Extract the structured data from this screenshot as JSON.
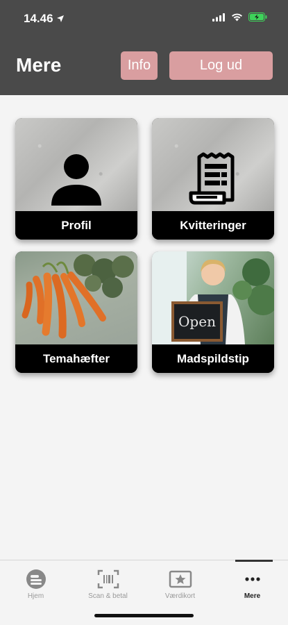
{
  "status_bar": {
    "time": "14.46"
  },
  "header": {
    "title": "Mere",
    "info_label": "Info",
    "logout_label": "Log ud"
  },
  "tiles": [
    {
      "label": "Profil",
      "icon": "person-icon"
    },
    {
      "label": "Kvitteringer",
      "icon": "receipt-icon"
    },
    {
      "label": "Temahæfter",
      "icon": "carrots-photo"
    },
    {
      "label": "Madspildstip",
      "icon": "open-sign-photo"
    }
  ],
  "tabbar": {
    "items": [
      {
        "label": "Hjem",
        "icon": "home-icon"
      },
      {
        "label": "Scan & betal",
        "icon": "barcode-scan-icon"
      },
      {
        "label": "Værdikort",
        "icon": "star-card-icon"
      },
      {
        "label": "Mere",
        "icon": "more-dots-icon",
        "active": true
      }
    ]
  },
  "colors": {
    "header_bg": "#4a4a4a",
    "button_bg": "#d99ea0",
    "page_bg": "#f4f4f4",
    "tile_label_bg": "#000000"
  }
}
